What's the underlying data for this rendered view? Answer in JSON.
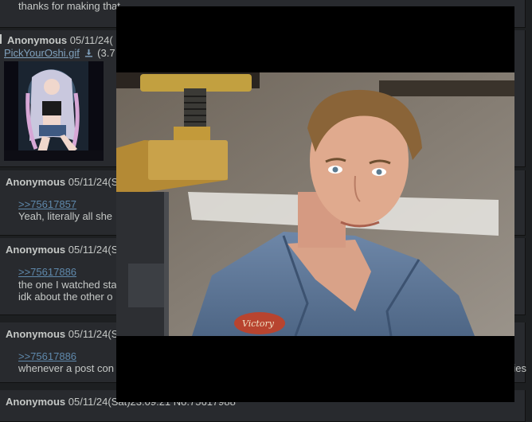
{
  "posts": [
    {
      "id": "p0",
      "body": "thanks for making that"
    },
    {
      "id": "p1",
      "name": "Anonymous",
      "date": "05/11/24(",
      "file_name": "PickYourOshi.gif",
      "file_size": "(3.7"
    },
    {
      "id": "p2",
      "name": "Anonymous",
      "date": "05/11/24(S",
      "quote": ">>75617857",
      "body": "Yeah, literally all she"
    },
    {
      "id": "p3",
      "name": "Anonymous",
      "date": "05/11/24(S",
      "quote": ">>75617886",
      "body_lines": [
        "the one I watched sta",
        "idk about the other o"
      ]
    },
    {
      "id": "p4",
      "name": "Anonymous",
      "date": "05/11/24(S",
      "quote": ">>75617886",
      "body": "whenever a post con",
      "body_tail": "ries"
    },
    {
      "id": "p5",
      "name": "Anonymous",
      "date": "05/11/24(Sat)23:09:21 No.75617988"
    }
  ],
  "lightbox": {
    "image_subject": "man-in-mechanic-shirt-under-car-lift",
    "patch_text": "Victory"
  },
  "colors": {
    "page_bg": "#1d1f21",
    "post_bg": "#282a2e",
    "text": "#c5c8c6",
    "link": "#5f89ac",
    "filelink": "#81a2be",
    "lightbox_bg": "#000000"
  }
}
